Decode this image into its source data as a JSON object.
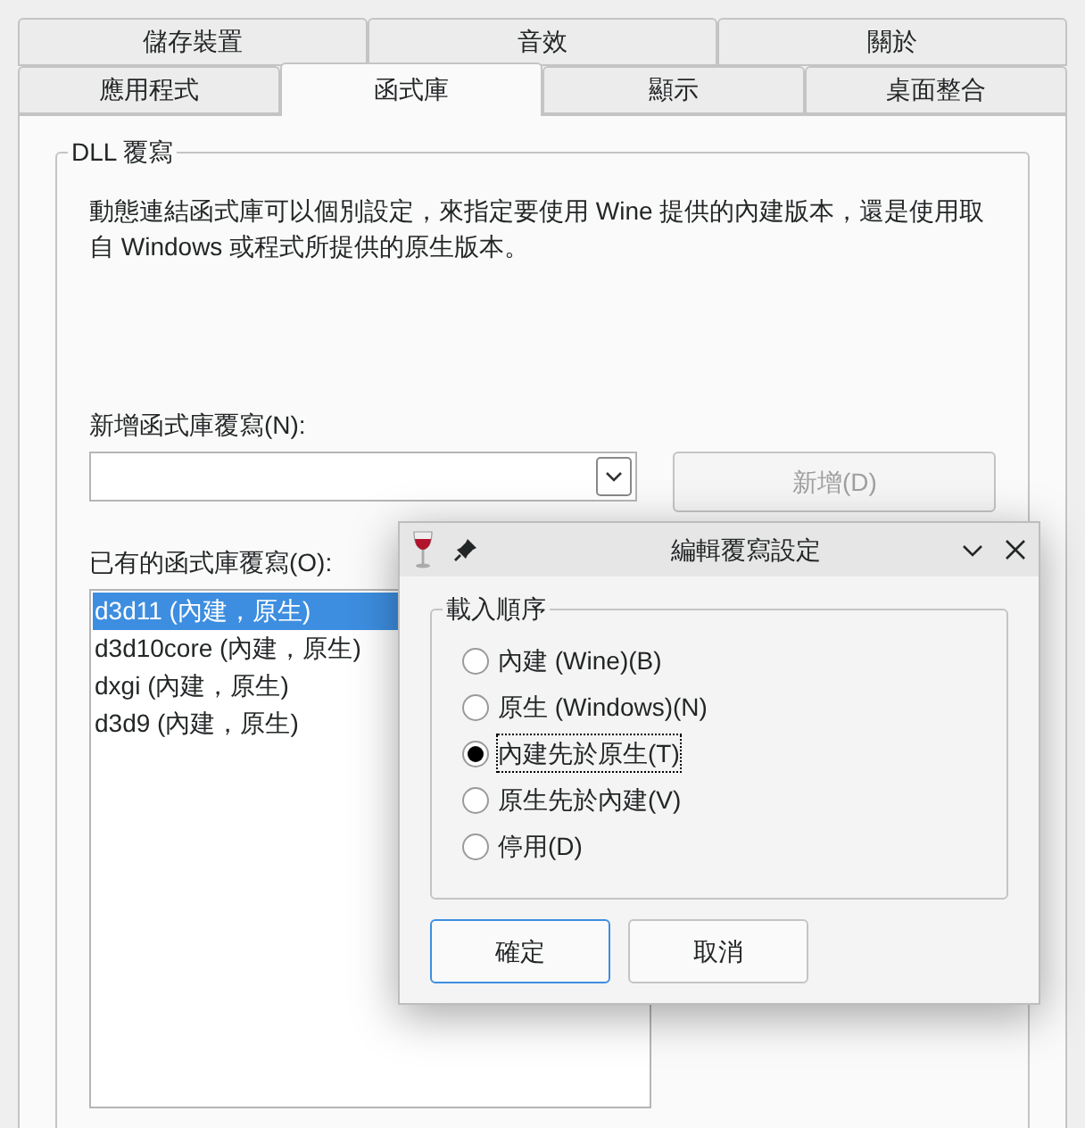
{
  "tab_rows": [
    {
      "tabs": [
        {
          "label": "儲存裝置",
          "selected": false
        },
        {
          "label": "音效",
          "selected": false
        },
        {
          "label": "關於",
          "selected": false
        }
      ]
    },
    {
      "tabs": [
        {
          "label": "應用程式",
          "selected": false
        },
        {
          "label": "函式庫",
          "selected": true
        },
        {
          "label": "顯示",
          "selected": false
        },
        {
          "label": "桌面整合",
          "selected": false
        }
      ]
    }
  ],
  "group": {
    "title": "DLL 覆寫",
    "description": "動態連結函式庫可以個別設定，來指定要使用 Wine 提供的內建版本，還是使用取自 Windows 或程式所提供的原生版本。"
  },
  "new_override": {
    "label": "新增函式庫覆寫(N):"
  },
  "add_button": {
    "label": "新增(D)",
    "disabled": true
  },
  "existing": {
    "label": "已有的函式庫覆寫(O):",
    "items": [
      {
        "text": "d3d11 (內建，原生)",
        "selected": true
      },
      {
        "text": "d3d10core (內建，原生)",
        "selected": false
      },
      {
        "text": "dxgi (內建，原生)",
        "selected": false
      },
      {
        "text": "d3d9 (內建，原生)",
        "selected": false
      }
    ]
  },
  "dialog": {
    "title": "編輯覆寫設定",
    "group_title": "載入順序",
    "options": [
      {
        "label": "內建 (Wine)(B)",
        "selected": false
      },
      {
        "label": "原生 (Windows)(N)",
        "selected": false
      },
      {
        "label": "內建先於原生(T)",
        "selected": true
      },
      {
        "label": "原生先於內建(V)",
        "selected": false
      },
      {
        "label": "停用(D)",
        "selected": false
      }
    ],
    "buttons": [
      {
        "label": "確定",
        "default": true
      },
      {
        "label": "取消",
        "default": false
      }
    ]
  }
}
